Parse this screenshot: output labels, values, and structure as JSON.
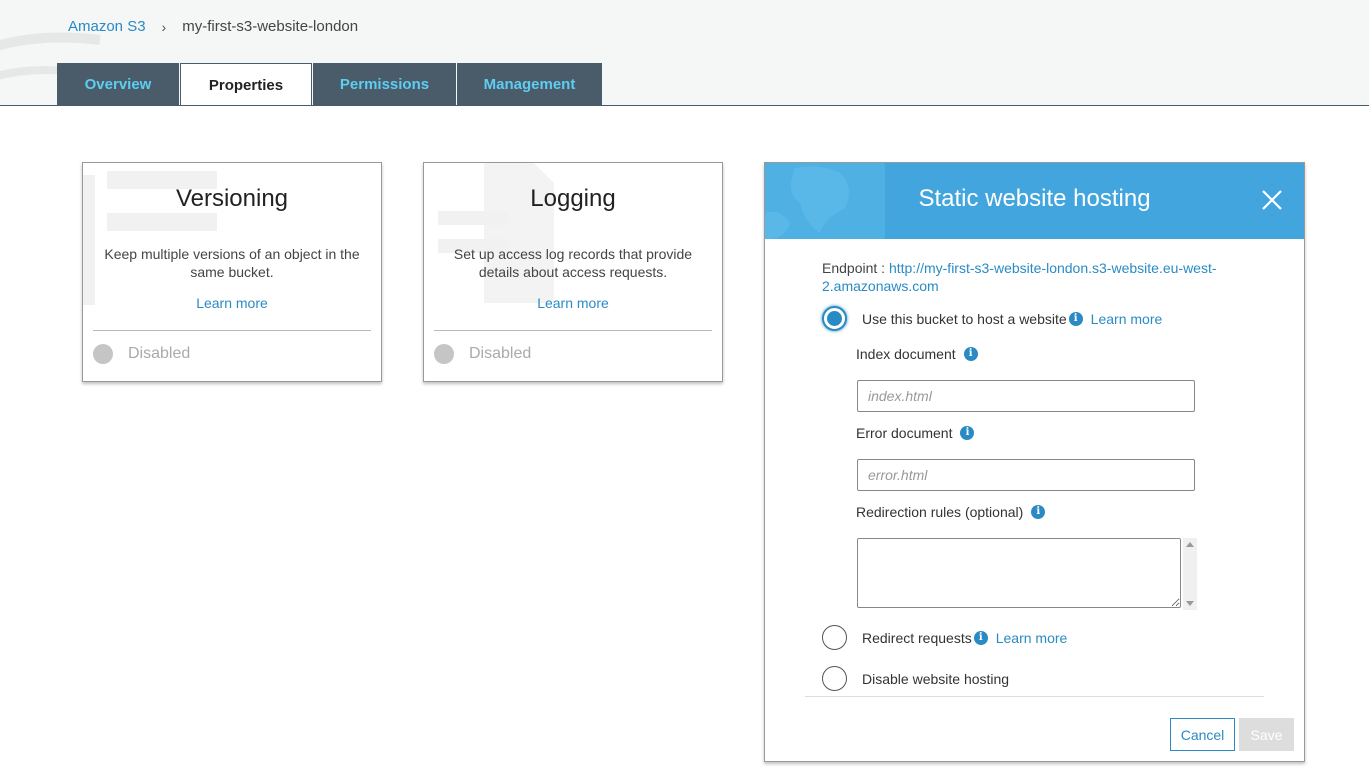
{
  "breadcrumb": {
    "root": "Amazon S3",
    "separator": "›",
    "current": "my-first-s3-website-london"
  },
  "tabs": [
    {
      "label": "Overview",
      "active": false
    },
    {
      "label": "Properties",
      "active": true
    },
    {
      "label": "Permissions",
      "active": false
    },
    {
      "label": "Management",
      "active": false
    }
  ],
  "cards": [
    {
      "title": "Versioning",
      "description": "Keep multiple versions of an object in the same bucket.",
      "link": "Learn more",
      "status": "Disabled"
    },
    {
      "title": "Logging",
      "description": "Set up access log records that provide details about access requests.",
      "link": "Learn more",
      "status": "Disabled"
    }
  ],
  "panel": {
    "title": "Static website hosting",
    "endpoint_label": "Endpoint :",
    "endpoint_url": "http://my-first-s3-website-london.s3-website.eu-west-2.amazonaws.com",
    "options": [
      {
        "label": "Use this bucket to host a website",
        "learn_more": "Learn more",
        "checked": true
      },
      {
        "label": "Redirect requests",
        "learn_more": "Learn more",
        "checked": false
      },
      {
        "label": "Disable website hosting",
        "checked": false
      }
    ],
    "index_document": {
      "label": "Index document",
      "placeholder": "index.html",
      "value": ""
    },
    "error_document": {
      "label": "Error document",
      "placeholder": "error.html",
      "value": ""
    },
    "redirection_rules": {
      "label": "Redirection rules (optional)",
      "value": ""
    },
    "cancel_label": "Cancel",
    "save_label": "Save"
  },
  "colors": {
    "accent": "#2a8bc4",
    "header_blue": "#42a5dd",
    "tab_dark": "#4a5b69",
    "tab_text": "#5ecdf2"
  },
  "icons": {
    "info": "info-icon",
    "close": "close-icon",
    "chevron": "chevron-right-icon"
  }
}
